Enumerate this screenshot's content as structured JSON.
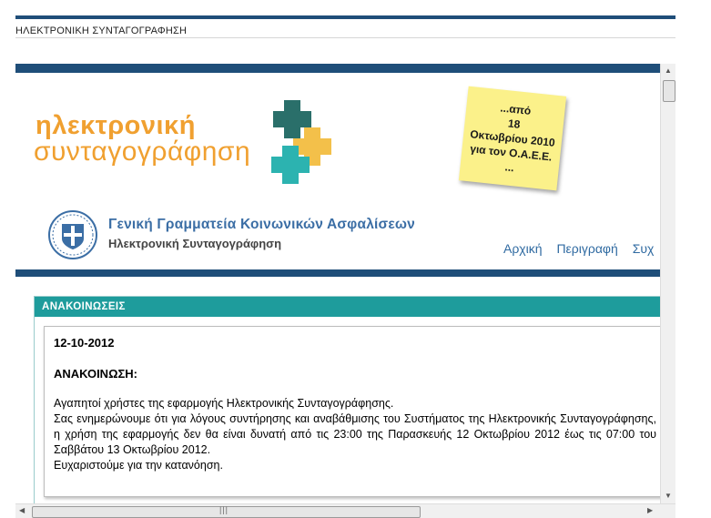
{
  "page": {
    "heading": "ΗΛΕΚΤΡΟΝΙΚΗ ΣΥΝΤΑΓΟΓΡΑΦΗΣΗ"
  },
  "banner": {
    "logo_line1": "ηλεκτρονική",
    "logo_line2": "συνταγογράφηση",
    "sticky_lines": [
      "...από",
      "18",
      "Οκτωβρίου 2010",
      "για τον Ο.Α.Ε.Ε.",
      "..."
    ],
    "org_name": "Γενική Γραμματεία Κοινωνικών Ασφαλίσεων",
    "org_subtitle": "Ηλεκτρονική Συνταγογράφηση"
  },
  "nav": {
    "items": [
      "Αρχική",
      "Περιγραφή",
      "Συχ"
    ]
  },
  "announcements": {
    "header": "ΑΝΑΚΟΙΝΩΣΕΙΣ",
    "date": "12-10-2012",
    "title": "ΑΝΑΚΟΙΝΩΣΗ:",
    "paragraph1": "Αγαπητοί χρήστες της εφαρμογής Ηλεκτρονικής Συνταγογράφησης.",
    "paragraph2": "Σας ενημερώνουμε ότι για λόγους συντήρησης και αναβάθμισης του Συστήματος της Ηλεκτρονικής Συνταγογράφησης, η χρήση της εφαρμογής δεν θα είναι δυνατή από τις 23:00 της Παρασκευής 12 Οκτωβρίου 2012 έως τις 07:00 του Σαββάτου 13 Οκτωβρίου 2012.",
    "paragraph3": "Ευχαριστούμε για την κατανόηση."
  },
  "colors": {
    "brand_blue": "#1f4e79",
    "teal": "#1e9c9c",
    "orange": "#f0a030",
    "link": "#2f6aa1"
  },
  "icons": {
    "seal": "greek-emblem-icon",
    "puzzle": "puzzle-pieces-icon",
    "scroll_up": "arrow-up-icon",
    "scroll_down": "arrow-down-icon",
    "scroll_left": "arrow-left-icon",
    "scroll_right": "arrow-right-icon"
  }
}
